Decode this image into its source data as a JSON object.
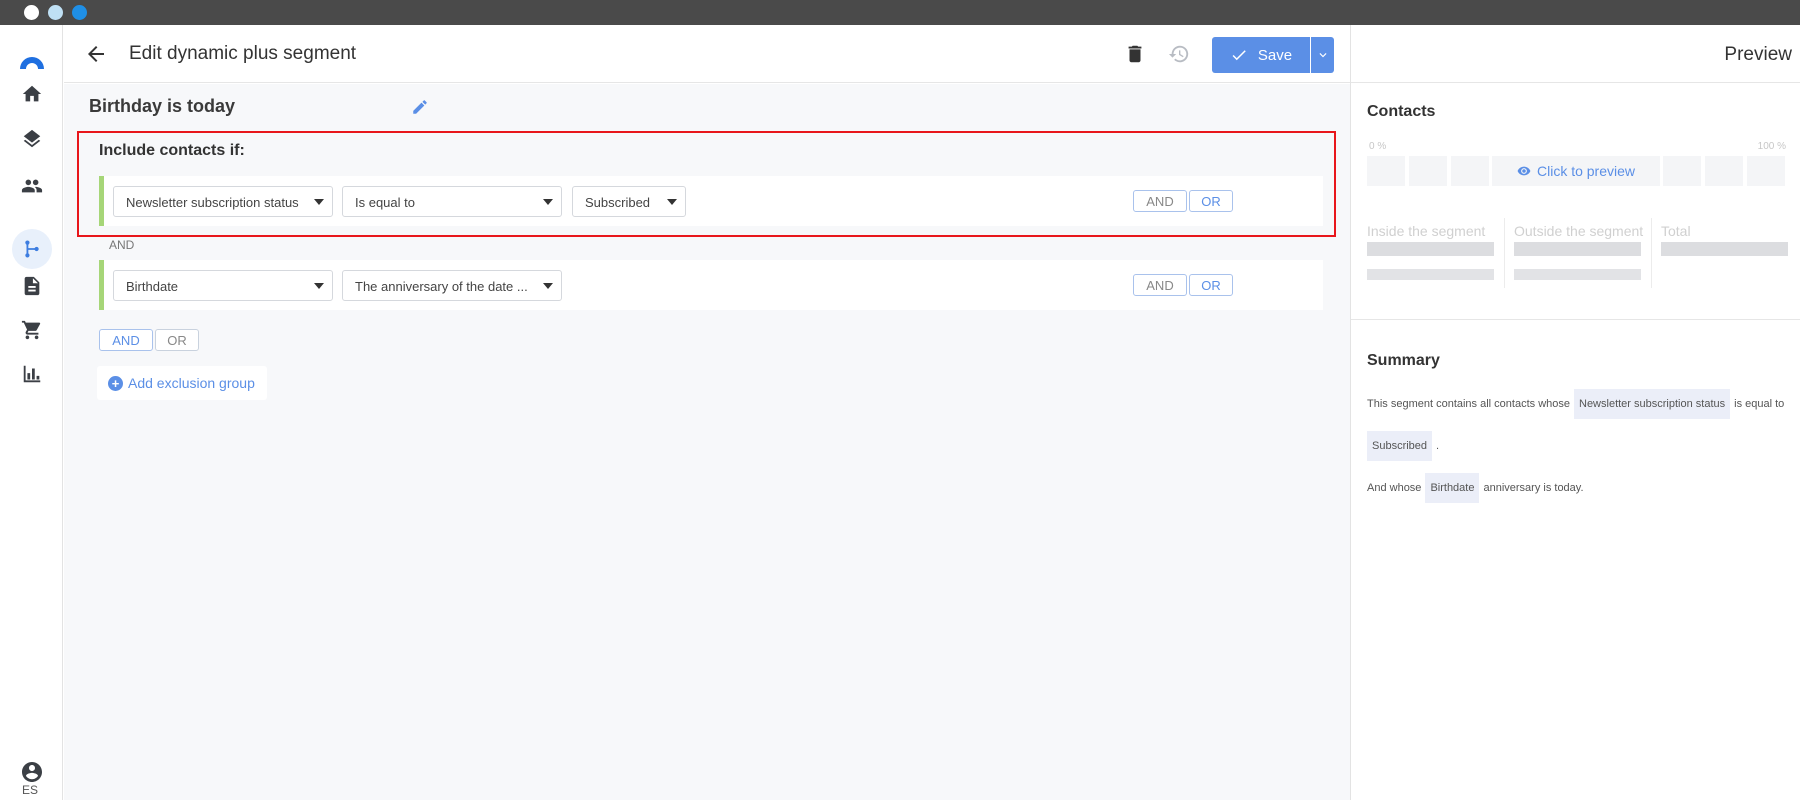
{
  "header": {
    "title": "Edit dynamic plus segment",
    "save_label": "Save"
  },
  "segment": {
    "name": "Birthday is today",
    "include_label": "Include contacts if:",
    "conditions": [
      {
        "field": "Newsletter subscription status",
        "operator": "Is equal to",
        "value": "Subscribed"
      },
      {
        "field": "Birthdate",
        "operator": "The anniversary of the date ..."
      }
    ],
    "connector_label": "AND",
    "and_label": "AND",
    "or_label": "OR",
    "add_exclusion_label": "Add exclusion group"
  },
  "sidebar": {
    "items": [
      "home-icon",
      "layers-icon",
      "contacts-icon",
      "segments-icon",
      "document-icon",
      "cart-icon",
      "reports-icon"
    ],
    "active": "segments-icon",
    "language": "ES"
  },
  "preview": {
    "title": "Preview",
    "contacts_title": "Contacts",
    "pct_min": "0 %",
    "pct_max": "100 %",
    "click_label": "Click to preview",
    "inside_label": "Inside the segment",
    "outside_label": "Outside the segment",
    "total_label": "Total",
    "summary_title": "Summary",
    "summary": {
      "line1_prefix": "This segment contains all contacts whose",
      "chip_field": "Newsletter subscription status",
      "line1_suffix": "is equal to",
      "chip_value": "Subscribed",
      "line2_suffix": ".",
      "line3_prefix": "And whose",
      "chip_date": "Birthdate",
      "line3_suffix": "anniversary is today."
    }
  },
  "colors": {
    "accent": "#5b8fe6",
    "highlight": "#e8161b",
    "condition_bar": "#a6d678",
    "chrome": "#4a4a4a"
  }
}
